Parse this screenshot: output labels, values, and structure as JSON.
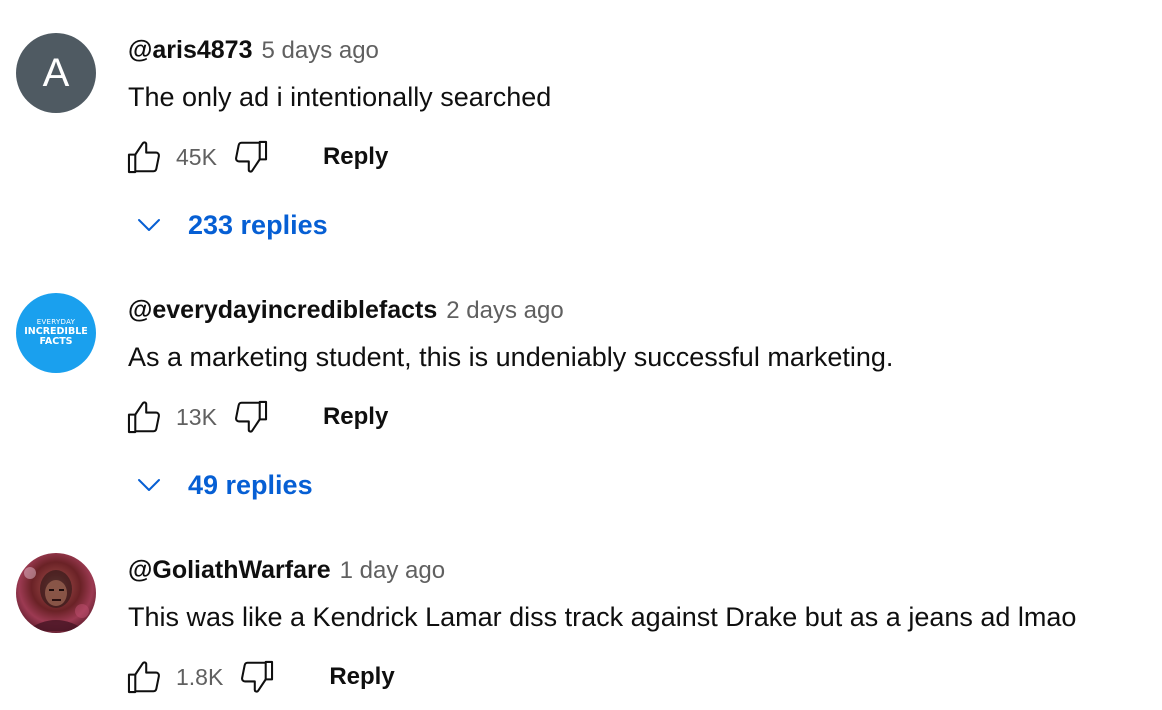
{
  "comments": [
    {
      "avatar_letter": "A",
      "avatar_color": "#4f5a62",
      "author": "@aris4873",
      "timestamp": "5 days ago",
      "text": "The only ad i intentionally searched",
      "likes": "45K",
      "reply_label": "Reply",
      "replies_label": "233 replies"
    },
    {
      "avatar_lines": [
        "EVERYDAY",
        "INCREDIBLE",
        "FACTS"
      ],
      "avatar_color": "#1aa0ee",
      "author": "@everydayincrediblefacts",
      "timestamp": "2 days ago",
      "text": "As a marketing student, this is undeniably successful marketing.",
      "likes": "13K",
      "reply_label": "Reply",
      "replies_label": "49 replies"
    },
    {
      "author": "@GoliathWarfare",
      "timestamp": "1 day ago",
      "text": "This was like a Kendrick Lamar diss track against Drake but as a jeans ad lmao",
      "likes": "1.8K",
      "reply_label": "Reply"
    }
  ],
  "colors": {
    "link_blue": "#065fd4",
    "meta_gray": "#606060",
    "text": "#0f0f0f"
  },
  "icons": {
    "like": "thumb-up-icon",
    "dislike": "thumb-down-icon",
    "expand": "chevron-down-icon"
  }
}
